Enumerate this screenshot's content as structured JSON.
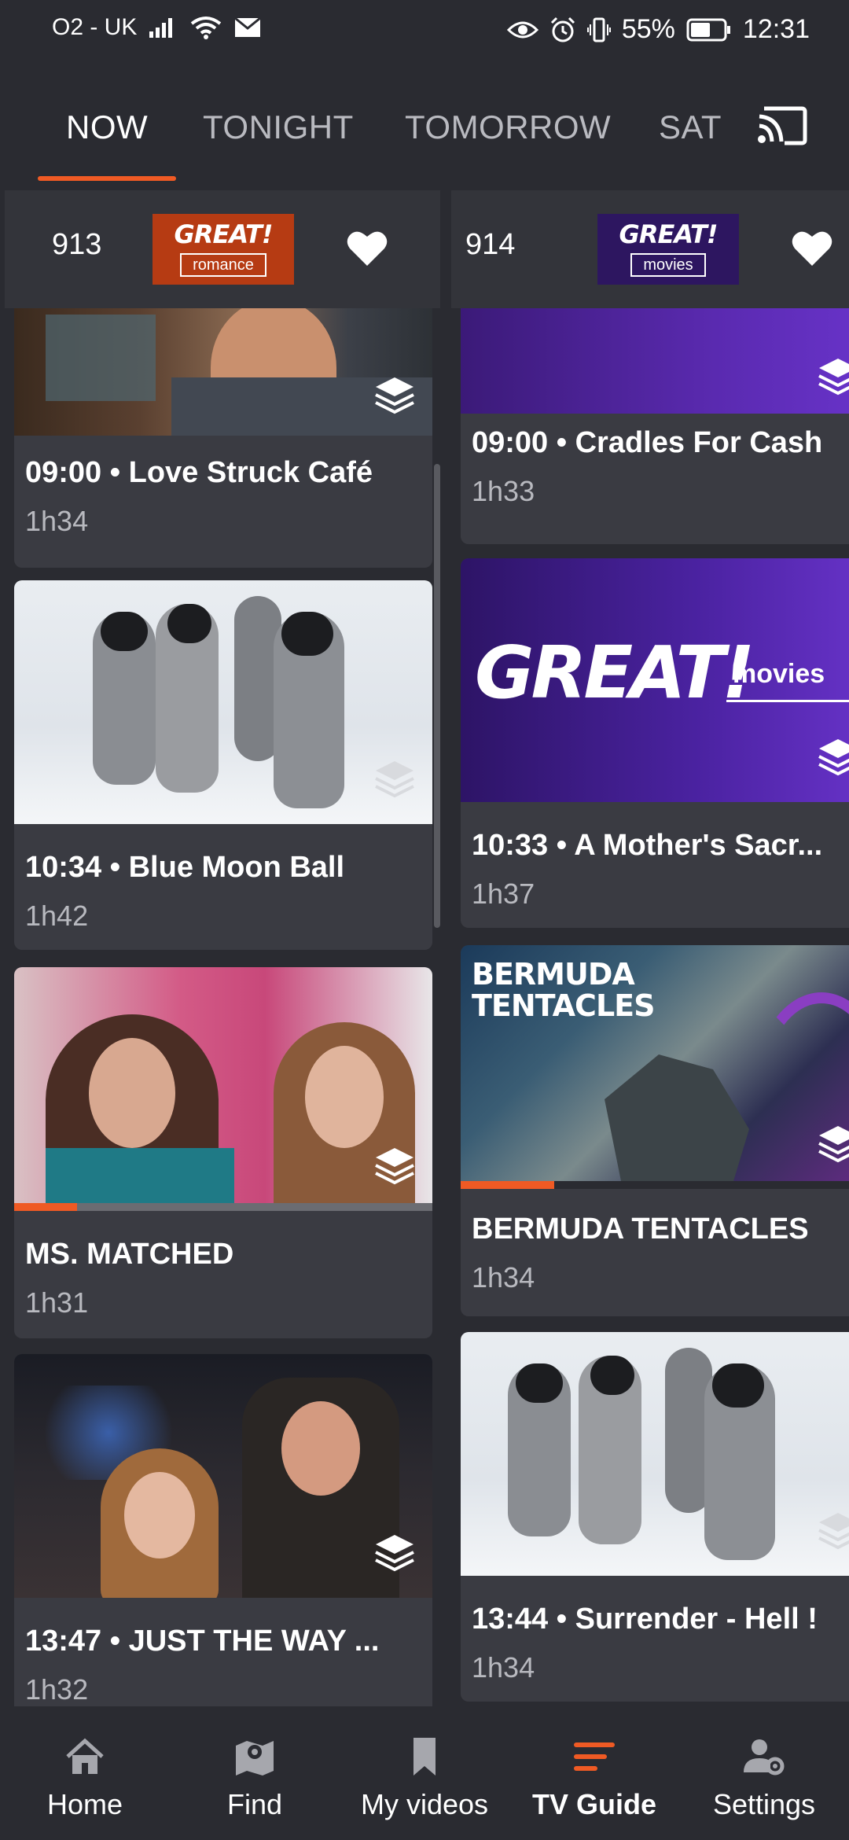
{
  "status": {
    "carrier": "O2 - UK",
    "battery": "55%",
    "time": "12:31"
  },
  "tabs": [
    {
      "label": "NOW",
      "active": true
    },
    {
      "label": "TONIGHT",
      "active": false
    },
    {
      "label": "TOMORROW",
      "active": false
    },
    {
      "label": "SAT",
      "active": false
    }
  ],
  "channels": [
    {
      "number": "913",
      "logo_text": "GREAT!",
      "logo_sub": "romance",
      "logo_color": "#b63b13",
      "programmes": [
        {
          "title": "09:00  •  Love Struck Café",
          "duration": "1h34"
        },
        {
          "title": "10:34  •  Blue Moon Ball",
          "duration": "1h42"
        },
        {
          "title": "MS. MATCHED",
          "duration": "1h31",
          "progress": 0.15
        },
        {
          "title": "13:47  •  JUST THE WAY ...",
          "duration": "1h32"
        }
      ]
    },
    {
      "number": "914",
      "logo_text": "GREAT!",
      "logo_sub": "movies",
      "logo_color": "#2d1660",
      "programmes": [
        {
          "title": "09:00  •  Cradles For Cash",
          "duration": "1h33"
        },
        {
          "title": "10:33  •  A Mother's Sacr...",
          "duration": "1h37",
          "thumb_text": "GREAT!",
          "thumb_sub": "movies"
        },
        {
          "title": "BERMUDA TENTACLES",
          "duration": "1h34",
          "progress": 0.22,
          "thumb_text": "BERMUDA TENTACLES"
        },
        {
          "title": "13:44  •  Surrender - Hell !",
          "duration": "1h34"
        }
      ]
    }
  ],
  "nav": [
    {
      "label": "Home",
      "icon": "home-icon",
      "active": false
    },
    {
      "label": "Find",
      "icon": "map-icon",
      "active": false
    },
    {
      "label": "My videos",
      "icon": "bookmark-icon",
      "active": false
    },
    {
      "label": "TV Guide",
      "icon": "guide-icon",
      "active": true
    },
    {
      "label": "Settings",
      "icon": "settings-icon",
      "active": false
    }
  ],
  "colors": {
    "accent": "#ef5a24",
    "background": "#2a2b31",
    "card": "#3a3b42"
  }
}
